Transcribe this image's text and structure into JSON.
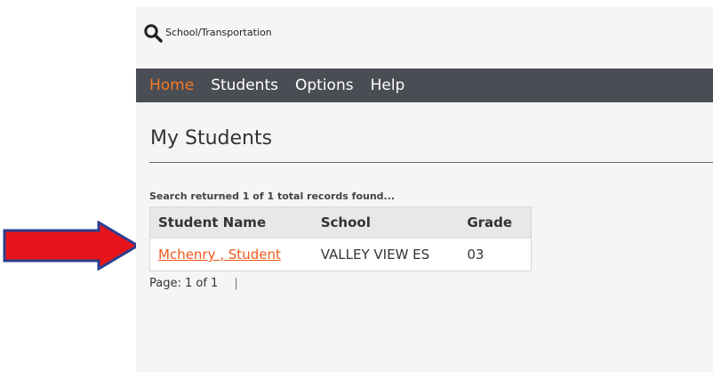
{
  "header": {
    "breadcrumb": "School/Transportation",
    "search_icon": "search-icon"
  },
  "nav": {
    "items": [
      {
        "label": "Home",
        "active": true
      },
      {
        "label": "Students",
        "active": false
      },
      {
        "label": "Options",
        "active": false
      },
      {
        "label": "Help",
        "active": false
      }
    ]
  },
  "main": {
    "title": "My Students",
    "result_note": "Search returned 1 of 1 total records found...",
    "table": {
      "columns": [
        "Student Name",
        "School",
        "Grade"
      ],
      "rows": [
        [
          "Mchenry , Student",
          "VALLEY VIEW ES",
          "03"
        ]
      ]
    },
    "pager": {
      "text": "Page: 1 of 1",
      "separator": "|"
    }
  },
  "colors": {
    "nav_bg": "#4b4d55",
    "active_nav": "#f47a20",
    "link": "#ee5a1a",
    "arrow_fill": "#e8141b",
    "arrow_stroke": "#2b3f8f"
  }
}
